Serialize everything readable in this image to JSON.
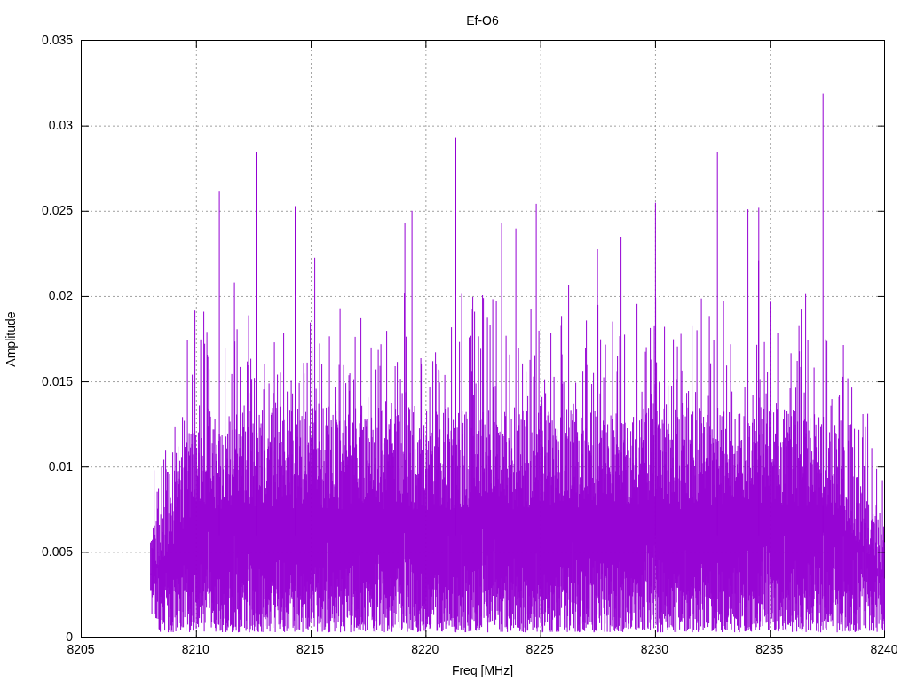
{
  "chart": {
    "title": "Ef-O6",
    "xlabel": "Freq [MHz]",
    "ylabel": "Amplitude",
    "xticks": [
      "8205",
      "8210",
      "8215",
      "8220",
      "8225",
      "8230",
      "8235",
      "8240"
    ],
    "yticks": [
      "0.035",
      "0.03",
      "0.025",
      "0.02",
      "0.015",
      "0.01",
      "0.005",
      "0"
    ]
  }
}
